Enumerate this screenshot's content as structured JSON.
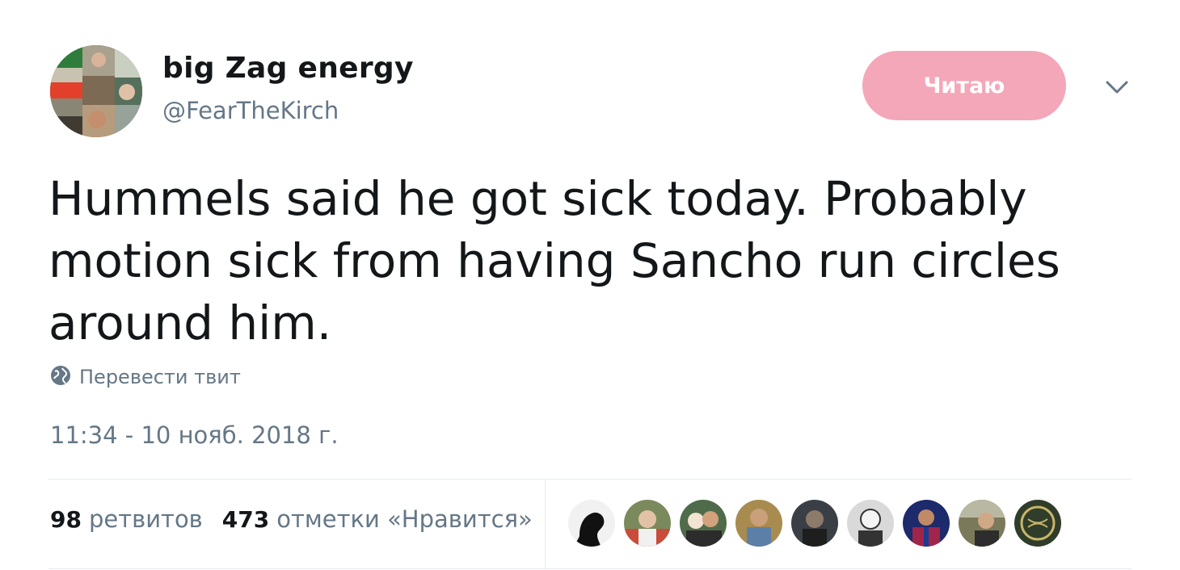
{
  "user": {
    "name": "big Zag energy",
    "handle": "@FearTheKirch"
  },
  "follow_button": {
    "label": "Читаю",
    "color": "#f4a7b9"
  },
  "menu": {
    "icon": "chevron-down-icon"
  },
  "tweet": {
    "text": "Hummels said he got sick today. Probably\nmotion sick from having Sancho run circles\naround him."
  },
  "translate": {
    "label": "Перевести твит",
    "icon": "globe-icon"
  },
  "timestamp": "11:34 - 10 нояб. 2018 г.",
  "stats": {
    "retweets": {
      "count": "98",
      "label": "ретвитов"
    },
    "likes": {
      "count": "473",
      "label": "отметки «Нравится»"
    }
  },
  "likers": {
    "count_shown": 9,
    "avatar_icons": [
      "liker-avatar-icon",
      "liker-avatar-icon",
      "liker-avatar-icon",
      "liker-avatar-icon",
      "liker-avatar-icon",
      "liker-avatar-icon",
      "liker-avatar-icon",
      "liker-avatar-icon",
      "liker-avatar-icon"
    ]
  },
  "colors": {
    "text_primary": "#14171a",
    "text_secondary": "#657786",
    "divider": "#e6ecf0"
  }
}
